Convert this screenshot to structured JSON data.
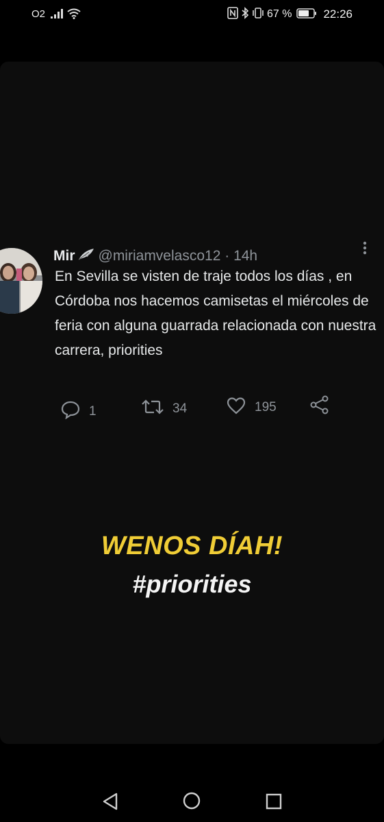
{
  "status_bar": {
    "carrier": "O2",
    "battery_percent": "67 %",
    "time": "22:26"
  },
  "tweet": {
    "display_name": "Mir",
    "handle": "@miriamvelasco12",
    "separator": "·",
    "time_ago": "14h",
    "text": "En Sevilla se visten de traje todos los días , en Córdoba nos hacemos camisetas el miércoles de feria con alguna guarrada relacionada con nuestra carrera, priorities",
    "reply_count": "1",
    "retweet_count": "34",
    "like_count": "195"
  },
  "overlay": {
    "title": "WENOS DÍAH!",
    "subtitle": "#priorities",
    "title_color": "#f0cd36"
  },
  "icons": {
    "status": [
      "signal-icon",
      "wifi-icon",
      "nfc-icon",
      "bluetooth-icon",
      "vibrate-icon",
      "battery-icon"
    ],
    "tweet": [
      "more-icon",
      "reply-icon",
      "retweet-icon",
      "like-icon",
      "share-icon"
    ],
    "nav": [
      "back-icon",
      "home-icon",
      "recents-icon"
    ]
  }
}
